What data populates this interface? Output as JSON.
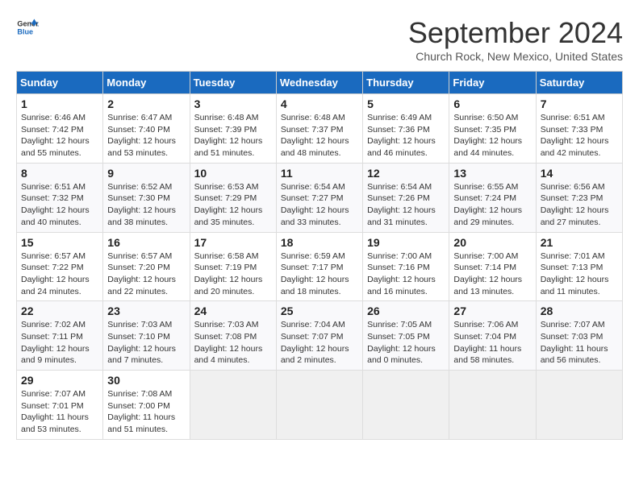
{
  "header": {
    "logo_line1": "General",
    "logo_line2": "Blue",
    "title": "September 2024",
    "subtitle": "Church Rock, New Mexico, United States"
  },
  "columns": [
    "Sunday",
    "Monday",
    "Tuesday",
    "Wednesday",
    "Thursday",
    "Friday",
    "Saturday"
  ],
  "weeks": [
    [
      {
        "day": "1",
        "info": "Sunrise: 6:46 AM\nSunset: 7:42 PM\nDaylight: 12 hours\nand 55 minutes."
      },
      {
        "day": "2",
        "info": "Sunrise: 6:47 AM\nSunset: 7:40 PM\nDaylight: 12 hours\nand 53 minutes."
      },
      {
        "day": "3",
        "info": "Sunrise: 6:48 AM\nSunset: 7:39 PM\nDaylight: 12 hours\nand 51 minutes."
      },
      {
        "day": "4",
        "info": "Sunrise: 6:48 AM\nSunset: 7:37 PM\nDaylight: 12 hours\nand 48 minutes."
      },
      {
        "day": "5",
        "info": "Sunrise: 6:49 AM\nSunset: 7:36 PM\nDaylight: 12 hours\nand 46 minutes."
      },
      {
        "day": "6",
        "info": "Sunrise: 6:50 AM\nSunset: 7:35 PM\nDaylight: 12 hours\nand 44 minutes."
      },
      {
        "day": "7",
        "info": "Sunrise: 6:51 AM\nSunset: 7:33 PM\nDaylight: 12 hours\nand 42 minutes."
      }
    ],
    [
      {
        "day": "8",
        "info": "Sunrise: 6:51 AM\nSunset: 7:32 PM\nDaylight: 12 hours\nand 40 minutes."
      },
      {
        "day": "9",
        "info": "Sunrise: 6:52 AM\nSunset: 7:30 PM\nDaylight: 12 hours\nand 38 minutes."
      },
      {
        "day": "10",
        "info": "Sunrise: 6:53 AM\nSunset: 7:29 PM\nDaylight: 12 hours\nand 35 minutes."
      },
      {
        "day": "11",
        "info": "Sunrise: 6:54 AM\nSunset: 7:27 PM\nDaylight: 12 hours\nand 33 minutes."
      },
      {
        "day": "12",
        "info": "Sunrise: 6:54 AM\nSunset: 7:26 PM\nDaylight: 12 hours\nand 31 minutes."
      },
      {
        "day": "13",
        "info": "Sunrise: 6:55 AM\nSunset: 7:24 PM\nDaylight: 12 hours\nand 29 minutes."
      },
      {
        "day": "14",
        "info": "Sunrise: 6:56 AM\nSunset: 7:23 PM\nDaylight: 12 hours\nand 27 minutes."
      }
    ],
    [
      {
        "day": "15",
        "info": "Sunrise: 6:57 AM\nSunset: 7:22 PM\nDaylight: 12 hours\nand 24 minutes."
      },
      {
        "day": "16",
        "info": "Sunrise: 6:57 AM\nSunset: 7:20 PM\nDaylight: 12 hours\nand 22 minutes."
      },
      {
        "day": "17",
        "info": "Sunrise: 6:58 AM\nSunset: 7:19 PM\nDaylight: 12 hours\nand 20 minutes."
      },
      {
        "day": "18",
        "info": "Sunrise: 6:59 AM\nSunset: 7:17 PM\nDaylight: 12 hours\nand 18 minutes."
      },
      {
        "day": "19",
        "info": "Sunrise: 7:00 AM\nSunset: 7:16 PM\nDaylight: 12 hours\nand 16 minutes."
      },
      {
        "day": "20",
        "info": "Sunrise: 7:00 AM\nSunset: 7:14 PM\nDaylight: 12 hours\nand 13 minutes."
      },
      {
        "day": "21",
        "info": "Sunrise: 7:01 AM\nSunset: 7:13 PM\nDaylight: 12 hours\nand 11 minutes."
      }
    ],
    [
      {
        "day": "22",
        "info": "Sunrise: 7:02 AM\nSunset: 7:11 PM\nDaylight: 12 hours\nand 9 minutes."
      },
      {
        "day": "23",
        "info": "Sunrise: 7:03 AM\nSunset: 7:10 PM\nDaylight: 12 hours\nand 7 minutes."
      },
      {
        "day": "24",
        "info": "Sunrise: 7:03 AM\nSunset: 7:08 PM\nDaylight: 12 hours\nand 4 minutes."
      },
      {
        "day": "25",
        "info": "Sunrise: 7:04 AM\nSunset: 7:07 PM\nDaylight: 12 hours\nand 2 minutes."
      },
      {
        "day": "26",
        "info": "Sunrise: 7:05 AM\nSunset: 7:05 PM\nDaylight: 12 hours\nand 0 minutes."
      },
      {
        "day": "27",
        "info": "Sunrise: 7:06 AM\nSunset: 7:04 PM\nDaylight: 11 hours\nand 58 minutes."
      },
      {
        "day": "28",
        "info": "Sunrise: 7:07 AM\nSunset: 7:03 PM\nDaylight: 11 hours\nand 56 minutes."
      }
    ],
    [
      {
        "day": "29",
        "info": "Sunrise: 7:07 AM\nSunset: 7:01 PM\nDaylight: 11 hours\nand 53 minutes."
      },
      {
        "day": "30",
        "info": "Sunrise: 7:08 AM\nSunset: 7:00 PM\nDaylight: 11 hours\nand 51 minutes."
      },
      {
        "day": "",
        "info": ""
      },
      {
        "day": "",
        "info": ""
      },
      {
        "day": "",
        "info": ""
      },
      {
        "day": "",
        "info": ""
      },
      {
        "day": "",
        "info": ""
      }
    ]
  ]
}
